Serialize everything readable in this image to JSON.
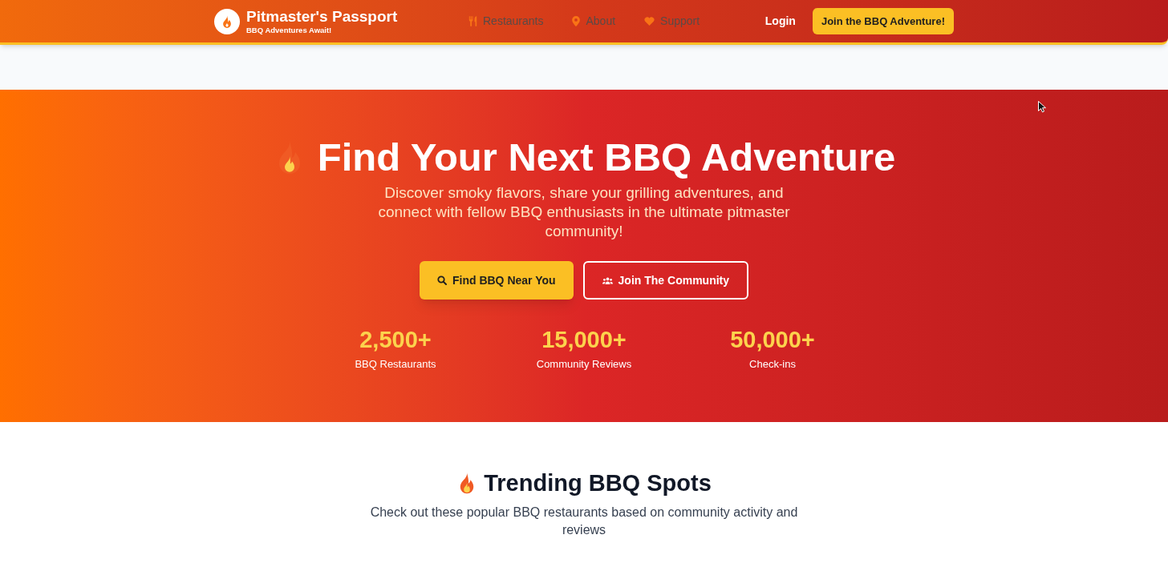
{
  "nav": {
    "brand": {
      "title": "Pitmaster's Passport",
      "tagline": "BBQ Adventures Await!"
    },
    "links": [
      {
        "label": "Restaurants"
      },
      {
        "label": "About"
      },
      {
        "label": "Support"
      }
    ],
    "login": "Login",
    "cta": "Join the BBQ Adventure!"
  },
  "hero": {
    "title": "Find Your Next BBQ Adventure",
    "subtitle": "Discover smoky flavors, share your grilling adventures, and connect with fellow BBQ enthusiasts in the ultimate pitmaster community!",
    "buttons": [
      {
        "label": "Find BBQ Near You",
        "kind": "primary"
      },
      {
        "label": "Join The Community",
        "kind": "outline"
      }
    ],
    "stats": [
      {
        "value": "2,500+",
        "label": "BBQ Restaurants"
      },
      {
        "value": "15,000+",
        "label": "Community Reviews"
      },
      {
        "value": "50,000+",
        "label": "Check-ins"
      }
    ]
  },
  "trending": {
    "title": "Trending BBQ Spots",
    "subtitle": "Check out these popular BBQ restaurants based on community activity and reviews"
  }
}
